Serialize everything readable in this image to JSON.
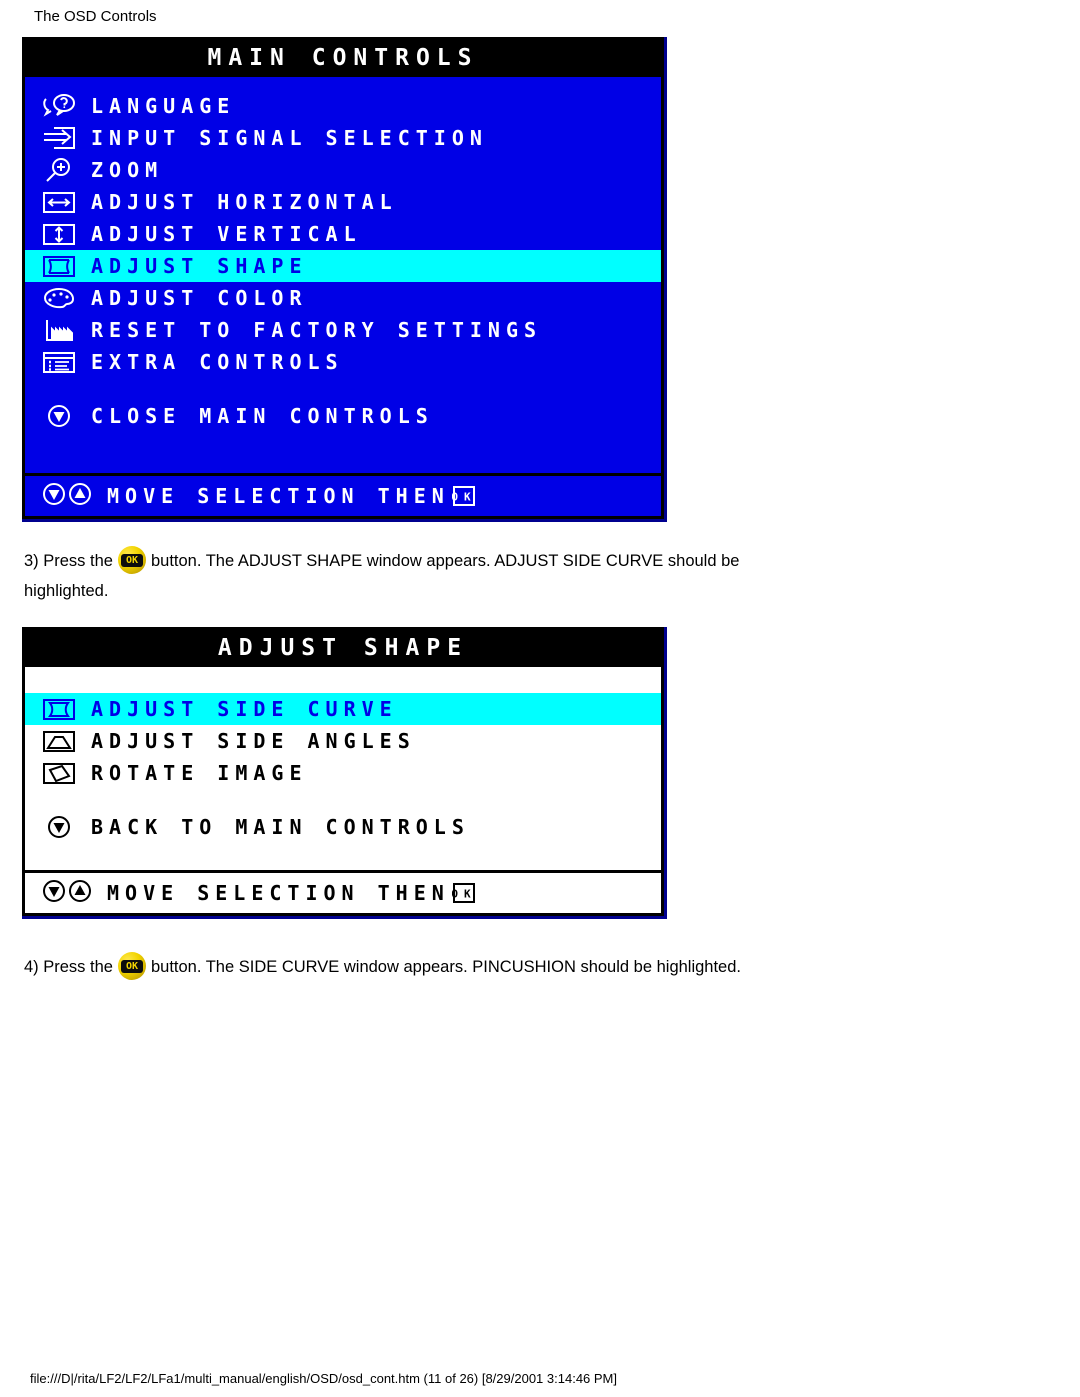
{
  "page": {
    "title": "The OSD Controls",
    "footer": "file:///D|/rita/LF2/LF2/LFa1/multi_manual/english/OSD/osd_cont.htm (11 of 26) [8/29/2001 3:14:46 PM]"
  },
  "colors": {
    "osd_blue": "#0000E6",
    "osd_highlight": "#00FFFF",
    "osd_titlebar": "#000000",
    "osd_white": "#FFFFFF",
    "osd_border": "#00008F",
    "ok_button_yellow": "#F2D400"
  },
  "osd_main": {
    "title": "MAIN CONTROLS",
    "items": [
      {
        "icon": "language-icon",
        "label": "LANGUAGE",
        "selected": false
      },
      {
        "icon": "input-signal-icon",
        "label": "INPUT SIGNAL SELECTION",
        "selected": false
      },
      {
        "icon": "zoom-magnifier-icon",
        "label": "ZOOM",
        "selected": false
      },
      {
        "icon": "horizontal-arrows-icon",
        "label": "ADJUST HORIZONTAL",
        "selected": false
      },
      {
        "icon": "vertical-arrows-icon",
        "label": "ADJUST VERTICAL",
        "selected": false
      },
      {
        "icon": "shape-frame-icon",
        "label": "ADJUST SHAPE",
        "selected": true
      },
      {
        "icon": "color-palette-icon",
        "label": "ADJUST COLOR",
        "selected": false
      },
      {
        "icon": "factory-reset-icon",
        "label": "RESET TO FACTORY SETTINGS",
        "selected": false
      },
      {
        "icon": "extra-controls-icon",
        "label": "EXTRA CONTROLS",
        "selected": false
      }
    ],
    "close_item": {
      "icon": "down-arrow-circle-icon",
      "label": "CLOSE MAIN CONTROLS"
    },
    "footer_hint": {
      "label": "MOVE SELECTION THEN",
      "icons": [
        "down-arrow-circle-icon",
        "up-arrow-circle-icon"
      ],
      "ok_glyph": "OK"
    }
  },
  "osd_shape": {
    "title": "ADJUST SHAPE",
    "items": [
      {
        "icon": "side-curve-icon",
        "label": "ADJUST SIDE CURVE",
        "selected": true
      },
      {
        "icon": "side-angles-icon",
        "label": "ADJUST SIDE ANGLES",
        "selected": false
      },
      {
        "icon": "rotate-image-icon",
        "label": "ROTATE IMAGE",
        "selected": false
      }
    ],
    "back_item": {
      "icon": "down-arrow-circle-icon",
      "label": "BACK TO MAIN CONTROLS"
    },
    "footer_hint": {
      "label": "MOVE SELECTION THEN",
      "icons": [
        "down-arrow-circle-icon",
        "up-arrow-circle-icon"
      ],
      "ok_glyph": "OK"
    }
  },
  "step3": {
    "line1_before": "3) Press the",
    "line1_after": "button. The ADJUST SHAPE window appears. ADJUST SIDE CURVE should be",
    "line2": "highlighted.",
    "ok_glyph": "OK"
  },
  "step4": {
    "line1_before": "4) Press the",
    "line1_after": "button. The SIDE CURVE window appears. PINCUSHION should be highlighted.",
    "ok_glyph": "OK"
  }
}
